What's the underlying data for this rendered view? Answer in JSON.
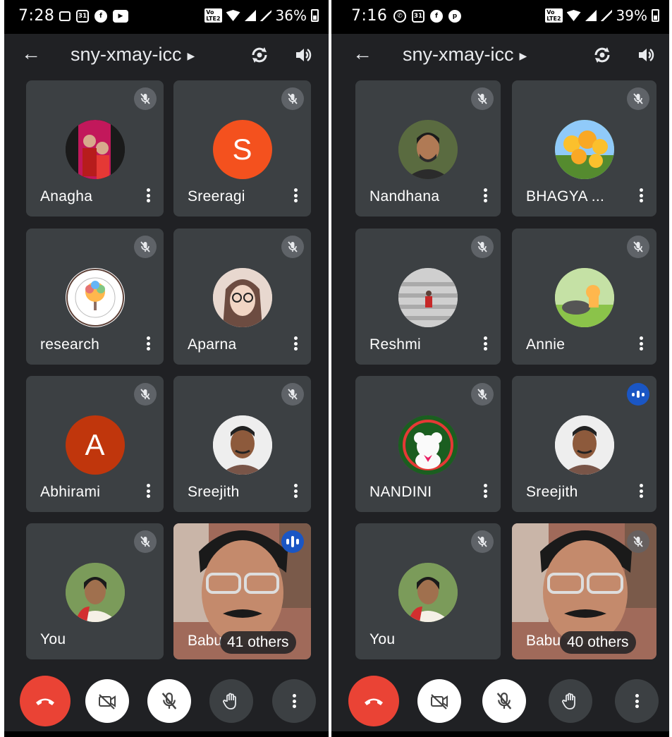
{
  "left": {
    "status": {
      "time": "7:28",
      "battery": "36%",
      "volte": "VoLTE 2"
    },
    "meeting_title": "sny-xmay-icc",
    "tiles": [
      {
        "name": "Anagha",
        "avatar_type": "photo",
        "avatar_color": "#b71c1c",
        "mic": "muted"
      },
      {
        "name": "Sreeragi",
        "avatar_type": "letter",
        "letter": "S",
        "avatar_color": "#f4511e",
        "mic": "muted"
      },
      {
        "name": "research",
        "avatar_type": "logo",
        "avatar_color": "#ffffff",
        "mic": "muted"
      },
      {
        "name": "Aparna",
        "avatar_type": "photo",
        "avatar_color": "#d7b8a8",
        "mic": "muted"
      },
      {
        "name": "Abhirami",
        "avatar_type": "letter",
        "letter": "A",
        "avatar_color": "#c0360c",
        "mic": "muted"
      },
      {
        "name": "Sreejith",
        "avatar_type": "photo",
        "avatar_color": "#8d6e63",
        "mic": "muted"
      },
      {
        "name": "You",
        "avatar_type": "photo",
        "avatar_color": "#9e7b62",
        "mic": "muted"
      }
    ],
    "video_tile": {
      "name": "Babu",
      "others": "41 others",
      "mic": "speaking"
    }
  },
  "right": {
    "status": {
      "time": "7:16",
      "battery": "39%",
      "volte": "VoLTE 2"
    },
    "meeting_title": "sny-xmay-icc",
    "tiles": [
      {
        "name": "Nandhana",
        "avatar_type": "photo",
        "avatar_color": "#4e5b3a",
        "mic": "muted"
      },
      {
        "name": "BHAGYA ...",
        "avatar_type": "photo",
        "avatar_color": "#e6b800",
        "mic": "muted"
      },
      {
        "name": "Reshmi",
        "avatar_type": "photo",
        "avatar_color": "#b0b0b0",
        "mic": "muted"
      },
      {
        "name": "Annie",
        "avatar_type": "photo",
        "avatar_color": "#9ccc65",
        "mic": "muted"
      },
      {
        "name": "NANDINI",
        "avatar_type": "photo",
        "avatar_color": "#2e7d32",
        "mic": "muted"
      },
      {
        "name": "Sreejith",
        "avatar_type": "photo",
        "avatar_color": "#8d6e63",
        "mic": "speaking"
      },
      {
        "name": "You",
        "avatar_type": "photo",
        "avatar_color": "#9e7b62",
        "mic": "muted"
      }
    ],
    "video_tile": {
      "name": "Babu",
      "others": "40 others",
      "mic": "muted"
    }
  },
  "colors": {
    "background": "#202124",
    "tile": "#3c4043",
    "end_call": "#ea4335",
    "speaking": "#1a56c4"
  },
  "icons": {
    "back": "back-arrow-icon",
    "switch_camera": "switch-camera-icon",
    "speaker": "speaker-icon",
    "mic_off": "mic-off-icon",
    "end_call": "phone-hangup-icon",
    "camera_off": "camera-off-icon",
    "raise_hand": "hand-icon",
    "more": "more-vert-icon"
  }
}
